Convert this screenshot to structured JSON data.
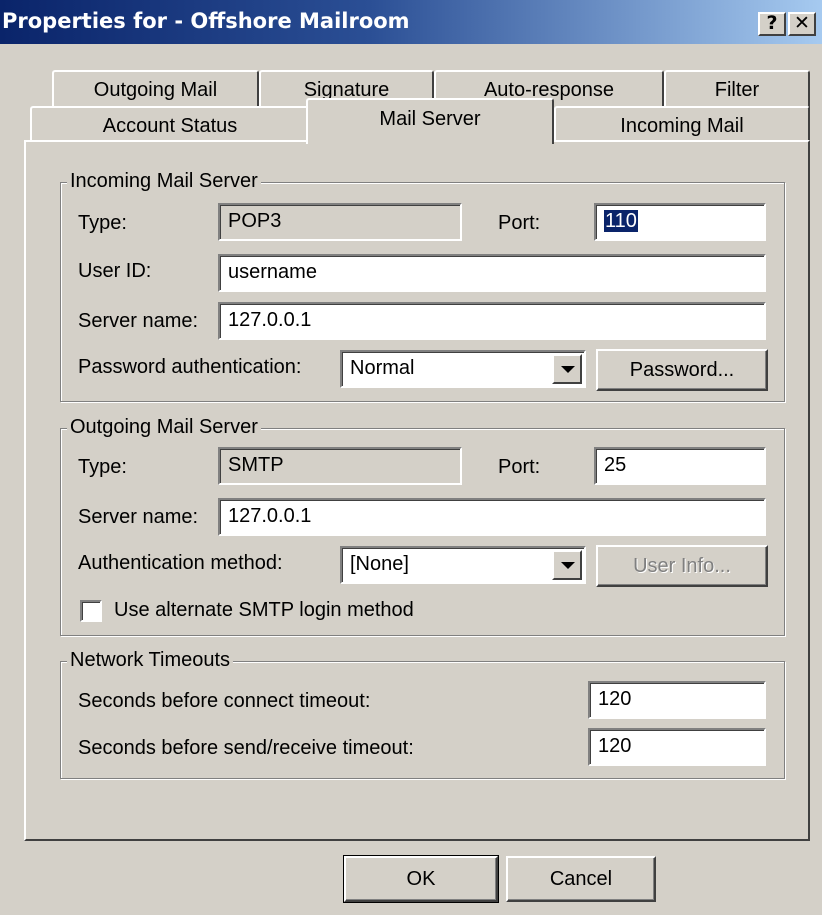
{
  "window": {
    "title": "Properties for - Offshore Mailroom",
    "help_label": "?",
    "close_label": "✕"
  },
  "tabs": {
    "row_back": [
      "Outgoing Mail",
      "Signature",
      "Auto-response",
      "Filter"
    ],
    "row_front": [
      "Account Status",
      "Mail Server",
      "Incoming Mail"
    ],
    "active": "Mail Server"
  },
  "incoming": {
    "legend": "Incoming Mail Server",
    "type_label": "Type:",
    "type_value": "POP3",
    "port_label": "Port:",
    "port_value": "110",
    "user_id_label": "User ID:",
    "user_id_value": "username",
    "server_name_label": "Server name:",
    "server_name_value": "127.0.0.1",
    "auth_label": "Password authentication:",
    "auth_value": "Normal",
    "password_button": "Password..."
  },
  "outgoing": {
    "legend": "Outgoing Mail Server",
    "type_label": "Type:",
    "type_value": "SMTP",
    "port_label": "Port:",
    "port_value": "25",
    "server_name_label": "Server name:",
    "server_name_value": "127.0.0.1",
    "auth_label": "Authentication method:",
    "auth_value": "[None]",
    "user_info_button": "User Info...",
    "alt_login_label": "Use alternate SMTP login method",
    "alt_login_checked": false
  },
  "timeouts": {
    "legend": "Network Timeouts",
    "connect_label": "Seconds before connect timeout:",
    "connect_value": "120",
    "sendrecv_label": "Seconds before send/receive timeout:",
    "sendrecv_value": "120"
  },
  "footer": {
    "ok_label": "OK",
    "cancel_label": "Cancel"
  }
}
